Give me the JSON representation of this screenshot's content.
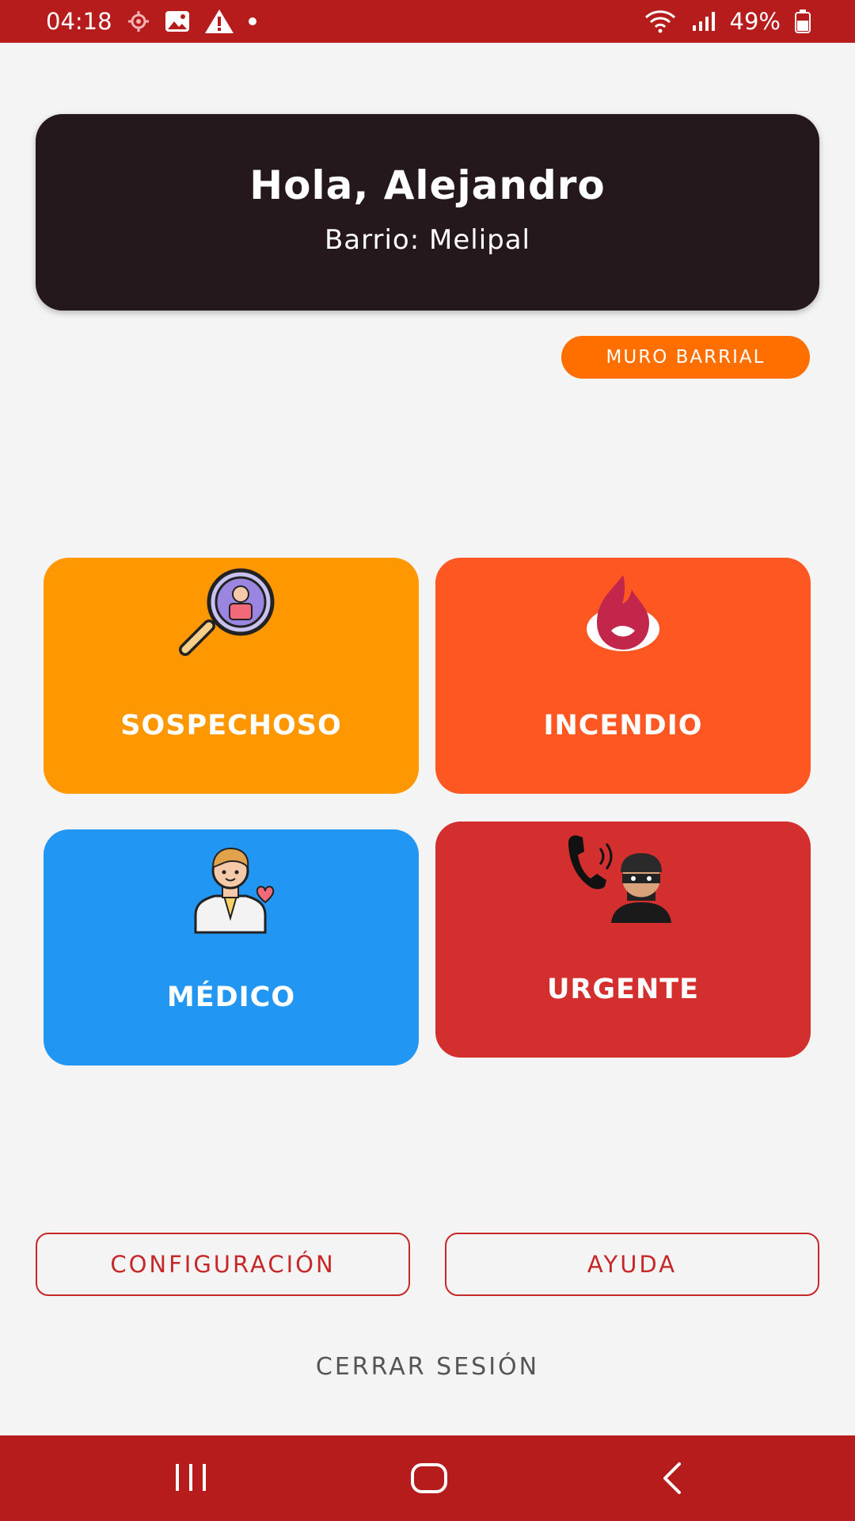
{
  "status_bar": {
    "time": "04:18",
    "battery": "49%",
    "icons": [
      "location-icon",
      "image-icon",
      "warning-icon",
      "dot-icon",
      "wifi-icon",
      "signal-icon",
      "battery-icon"
    ]
  },
  "greeting": {
    "title": "Hola, Alejandro",
    "neighborhood": "Barrio: Melipal"
  },
  "muro_button": "MURO BARRIAL",
  "tiles": [
    {
      "label": "SOSPECHOSO",
      "icon": "magnifier-person-icon",
      "color": "#ff9800"
    },
    {
      "label": "INCENDIO",
      "icon": "fire-icon",
      "color": "#ff5722"
    },
    {
      "label": "MÉDICO",
      "icon": "doctor-icon",
      "color": "#2196f3"
    },
    {
      "label": "URGENTE",
      "icon": "phone-thief-icon",
      "color": "#d32f2f"
    }
  ],
  "buttons": {
    "config": "CONFIGURACIÓN",
    "help": "AYUDA",
    "logout": "CERRAR SESIÓN"
  },
  "nav_bar": {
    "icons": [
      "recents-icon",
      "home-icon",
      "back-icon"
    ]
  },
  "colors": {
    "status_bar": "#b71c1c",
    "card": "#24181c",
    "accent_orange": "#ff6f00",
    "outline_red": "#c62828"
  }
}
